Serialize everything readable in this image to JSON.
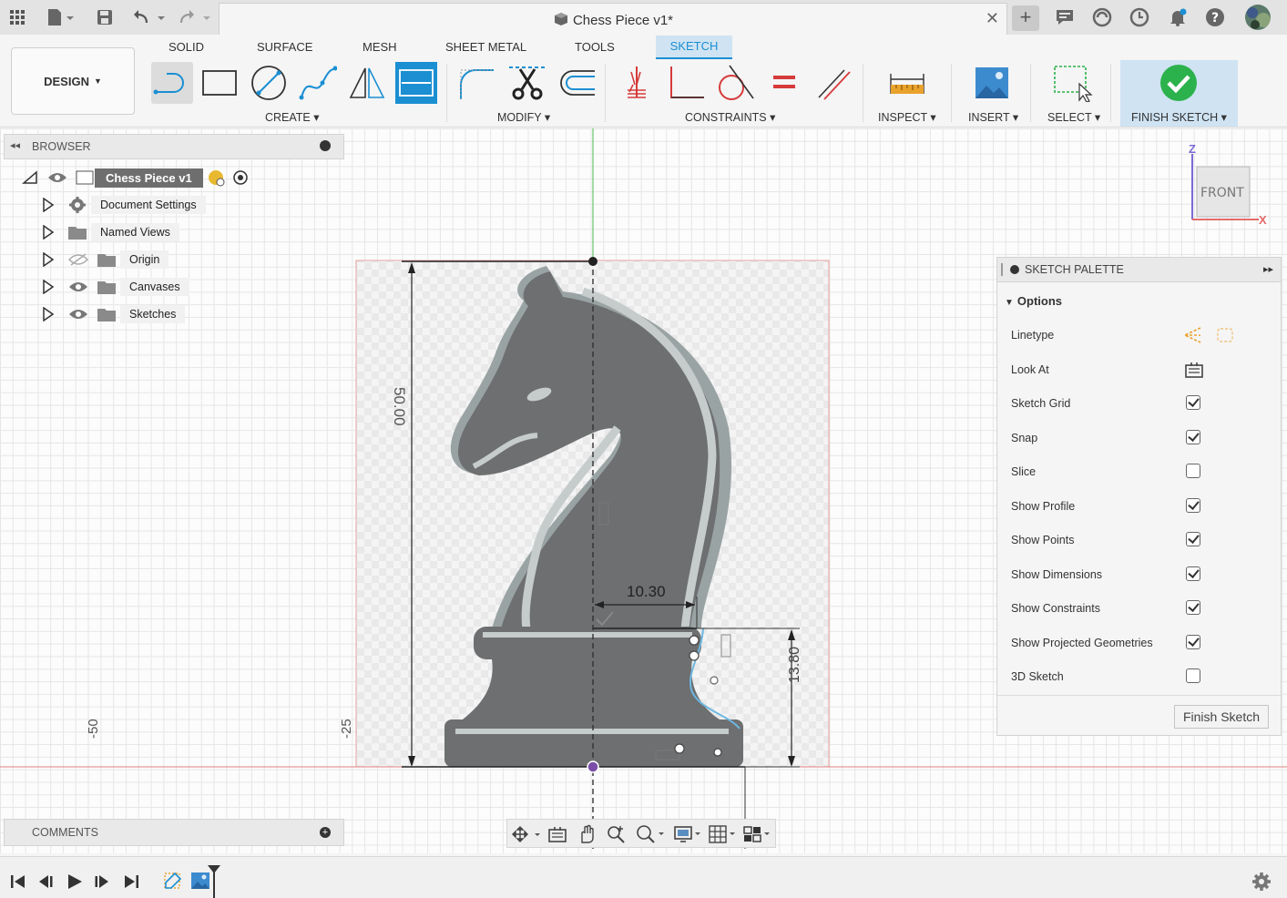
{
  "titlebar": {
    "document_title": "Chess Piece v1*",
    "icons": [
      "app-grid-icon",
      "file-icon",
      "save-icon",
      "undo-icon",
      "redo-icon",
      "new-tab-icon",
      "job-status-icon",
      "extensions-icon",
      "recent-icon",
      "notifications-icon",
      "help-icon",
      "user-avatar"
    ]
  },
  "toolbar": {
    "workspace": "DESIGN",
    "tabs": [
      "SOLID",
      "SURFACE",
      "MESH",
      "SHEET METAL",
      "TOOLS",
      "SKETCH"
    ],
    "active_tab": "SKETCH",
    "groups": {
      "create": "CREATE",
      "modify": "MODIFY",
      "constraints": "CONSTRAINTS",
      "inspect": "INSPECT",
      "insert": "INSERT",
      "select": "SELECT",
      "finish": "FINISH SKETCH"
    }
  },
  "browser": {
    "title": "BROWSER",
    "root": "Chess Piece v1",
    "items": [
      {
        "label": "Document Settings",
        "icon": "gear-icon"
      },
      {
        "label": "Named Views",
        "icon": "folder-icon"
      },
      {
        "label": "Origin",
        "icon": "folder-icon",
        "hidden": true
      },
      {
        "label": "Canvases",
        "icon": "folder-icon"
      },
      {
        "label": "Sketches",
        "icon": "folder-icon"
      }
    ]
  },
  "canvas": {
    "viewcube_label": "FRONT",
    "axis_z": "Z",
    "axis_x": "X",
    "dimensions": {
      "height": "50.00",
      "width": "10.30",
      "base": "13.80"
    },
    "ruler": {
      "left": "-50",
      "mid": "-25"
    }
  },
  "palette": {
    "title": "SKETCH PALETTE",
    "section": "Options",
    "options": [
      {
        "label": "Linetype",
        "type": "icons"
      },
      {
        "label": "Look At",
        "type": "icon"
      },
      {
        "label": "Sketch Grid",
        "checked": true
      },
      {
        "label": "Snap",
        "checked": true
      },
      {
        "label": "Slice",
        "checked": false
      },
      {
        "label": "Show Profile",
        "checked": true
      },
      {
        "label": "Show Points",
        "checked": true
      },
      {
        "label": "Show Dimensions",
        "checked": true
      },
      {
        "label": "Show Constraints",
        "checked": true
      },
      {
        "label": "Show Projected Geometries",
        "checked": true
      },
      {
        "label": "3D Sketch",
        "checked": false
      }
    ],
    "finish_button": "Finish Sketch"
  },
  "comments": {
    "title": "COMMENTS"
  },
  "colors": {
    "accent": "#1b8fd2",
    "finish_green": "#2bb24c",
    "constraint_red": "#d63b3b",
    "sketch_grey": "#6f6f6f"
  }
}
